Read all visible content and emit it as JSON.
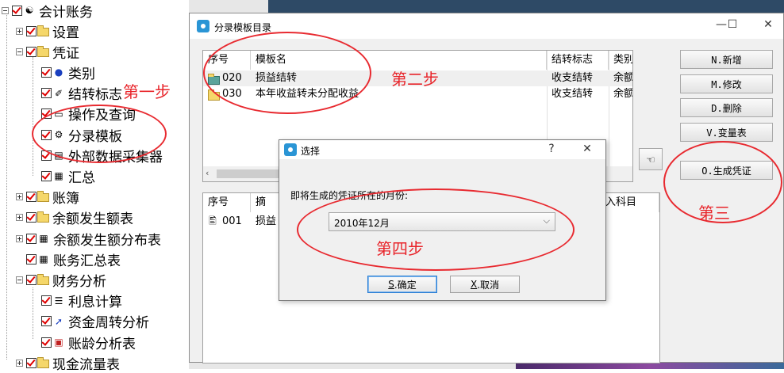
{
  "tree": {
    "root": "会计账务",
    "items": [
      {
        "label": "设置",
        "level": 1,
        "kind": "folder",
        "expanded": false
      },
      {
        "label": "凭证",
        "level": 1,
        "kind": "folder",
        "expanded": true
      },
      {
        "label": "类别",
        "level": 2,
        "kind": "leaf",
        "icon": "category-icon"
      },
      {
        "label": "结转标志",
        "level": 2,
        "kind": "leaf",
        "icon": "carryover-icon"
      },
      {
        "label": "操作及查询",
        "level": 2,
        "kind": "leaf",
        "icon": "query-icon"
      },
      {
        "label": "分录模板",
        "level": 2,
        "kind": "leaf",
        "icon": "template-icon"
      },
      {
        "label": "外部数据采集器",
        "level": 2,
        "kind": "leaf",
        "icon": "collector-icon"
      },
      {
        "label": "汇总",
        "level": 2,
        "kind": "leaf",
        "icon": "summary-icon"
      },
      {
        "label": "账簿",
        "level": 1,
        "kind": "folder",
        "expanded": false
      },
      {
        "label": "余额发生额表",
        "level": 1,
        "kind": "folder",
        "expanded": false
      },
      {
        "label": "余额发生额分布表",
        "level": 1,
        "kind": "report",
        "expanded": false
      },
      {
        "label": "账务汇总表",
        "level": 1,
        "kind": "report",
        "expanded": null
      },
      {
        "label": "财务分析",
        "level": 1,
        "kind": "folder",
        "expanded": true
      },
      {
        "label": "利息计算",
        "level": 2,
        "kind": "leaf",
        "icon": "interest-icon"
      },
      {
        "label": "资金周转分析",
        "level": 2,
        "kind": "leaf",
        "icon": "turnover-icon"
      },
      {
        "label": "账龄分析表",
        "level": 2,
        "kind": "leaf",
        "icon": "aging-icon"
      },
      {
        "label": "现金流量表",
        "level": 1,
        "kind": "folder",
        "expanded": false
      }
    ]
  },
  "window": {
    "title": "分录模板目录",
    "controls": {
      "minimize": "—",
      "maximize": "☐",
      "close": "✕"
    },
    "top_grid": {
      "headers": [
        "序号",
        "模板名",
        "结转标志",
        "类别"
      ],
      "rows": [
        {
          "no": "020",
          "name": "损益结转",
          "flag": "收支结转",
          "type": "余额"
        },
        {
          "no": "030",
          "name": "本年收益转未分配收益",
          "flag": "收支结转",
          "type": "余额"
        }
      ]
    },
    "bottom_grid": {
      "headers": [
        "序号",
        "摘",
        "入科目"
      ],
      "rows": [
        {
          "no": "001",
          "summary": "损益"
        }
      ]
    },
    "buttons": {
      "add": "N.新增",
      "edit": "M.修改",
      "delete": "D.删除",
      "variables": "V.变量表",
      "generate": "O.生成凭证"
    }
  },
  "dialog": {
    "title": "选择",
    "help": "?",
    "close": "✕",
    "prompt": "即将生成的凭证所在的月份:",
    "month_value": "2010年12月",
    "ok_key": "S",
    "ok_label": ".确定",
    "cancel_key": "X",
    "cancel_label": ".取消"
  },
  "annotations": {
    "step1": "第一步",
    "step2": "第二步",
    "step3": "第三",
    "step4": "第四步",
    "color": "#e8242a"
  }
}
